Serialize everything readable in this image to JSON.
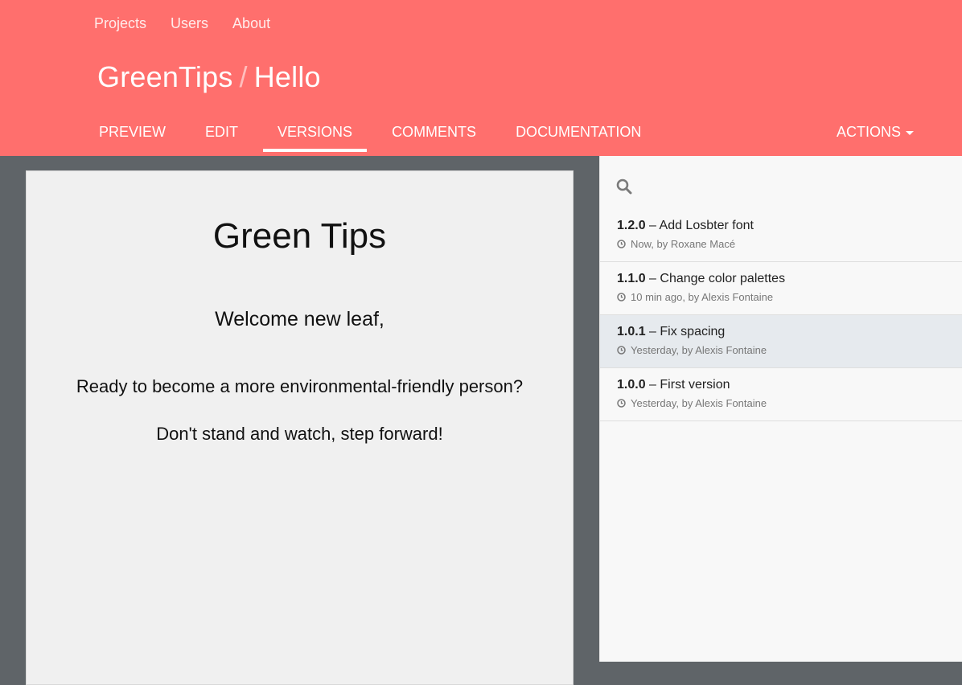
{
  "top_nav": [
    "Projects",
    "Users",
    "About"
  ],
  "breadcrumb": {
    "project": "GreenTips",
    "separator": "/",
    "page": "Hello"
  },
  "tabs": [
    {
      "label": "PREVIEW",
      "active": false
    },
    {
      "label": "EDIT",
      "active": false
    },
    {
      "label": "VERSIONS",
      "active": true
    },
    {
      "label": "COMMENTS",
      "active": false
    },
    {
      "label": "DOCUMENTATION",
      "active": false
    }
  ],
  "actions_label": "ACTIONS",
  "preview": {
    "title": "Green Tips",
    "welcome": "Welcome new leaf,",
    "line1": "Ready to become a more environmental-friendly person?",
    "line2": "Don't stand and watch, step forward!"
  },
  "versions": [
    {
      "number": "1.2.0",
      "message": "Add Losbter font",
      "meta": "Now, by Roxane Macé",
      "selected": false
    },
    {
      "number": "1.1.0",
      "message": "Change color palettes",
      "meta": "10 min ago, by Alexis Fontaine",
      "selected": false
    },
    {
      "number": "1.0.1",
      "message": "Fix spacing",
      "meta": "Yesterday, by Alexis Fontaine",
      "selected": true
    },
    {
      "number": "1.0.0",
      "message": "First version",
      "meta": "Yesterday, by Alexis Fontaine",
      "selected": false
    }
  ],
  "version_separator": "–",
  "colors": {
    "header": "#ff6f6d",
    "background": "#5f6468",
    "paper": "#f0f0f0",
    "panel": "#f8f8f8",
    "selected_row": "#e6eaee"
  },
  "icons": {
    "search": "search-icon",
    "clock": "clock-icon",
    "caret": "chevron-down-icon"
  }
}
